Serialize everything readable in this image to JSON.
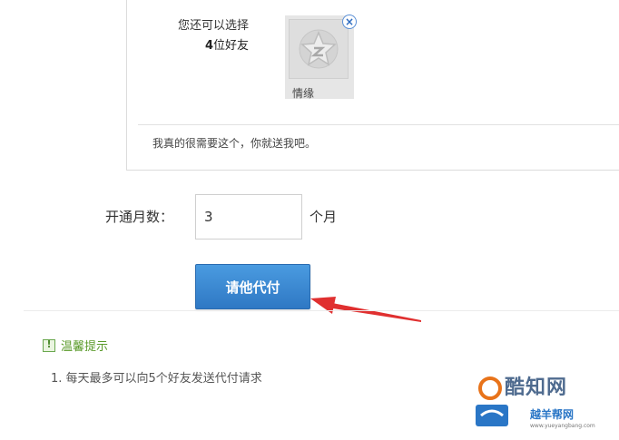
{
  "friend_picker": {
    "choose_prefix": "您还可以选择",
    "choose_count": "4",
    "choose_suffix": "位好友",
    "friend": {
      "name": "情缘",
      "remove_symbol": "×"
    },
    "message": "我真的很需要这个，你就送我吧。"
  },
  "months": {
    "label": "开通月数：",
    "value": "3",
    "unit": "个月"
  },
  "pay_button": {
    "label": "请他代付"
  },
  "tips": {
    "title": "温馨提示",
    "items": [
      "1. 每天最多可以向5个好友发送代付请求"
    ]
  },
  "watermark": {
    "name": "酷知网",
    "sub": "越羊帮网",
    "url": "www.yueyangbang.com"
  },
  "colors": {
    "button": "#3a86d4",
    "arrow": "#e03030",
    "tips_green": "#5a9a2a"
  }
}
